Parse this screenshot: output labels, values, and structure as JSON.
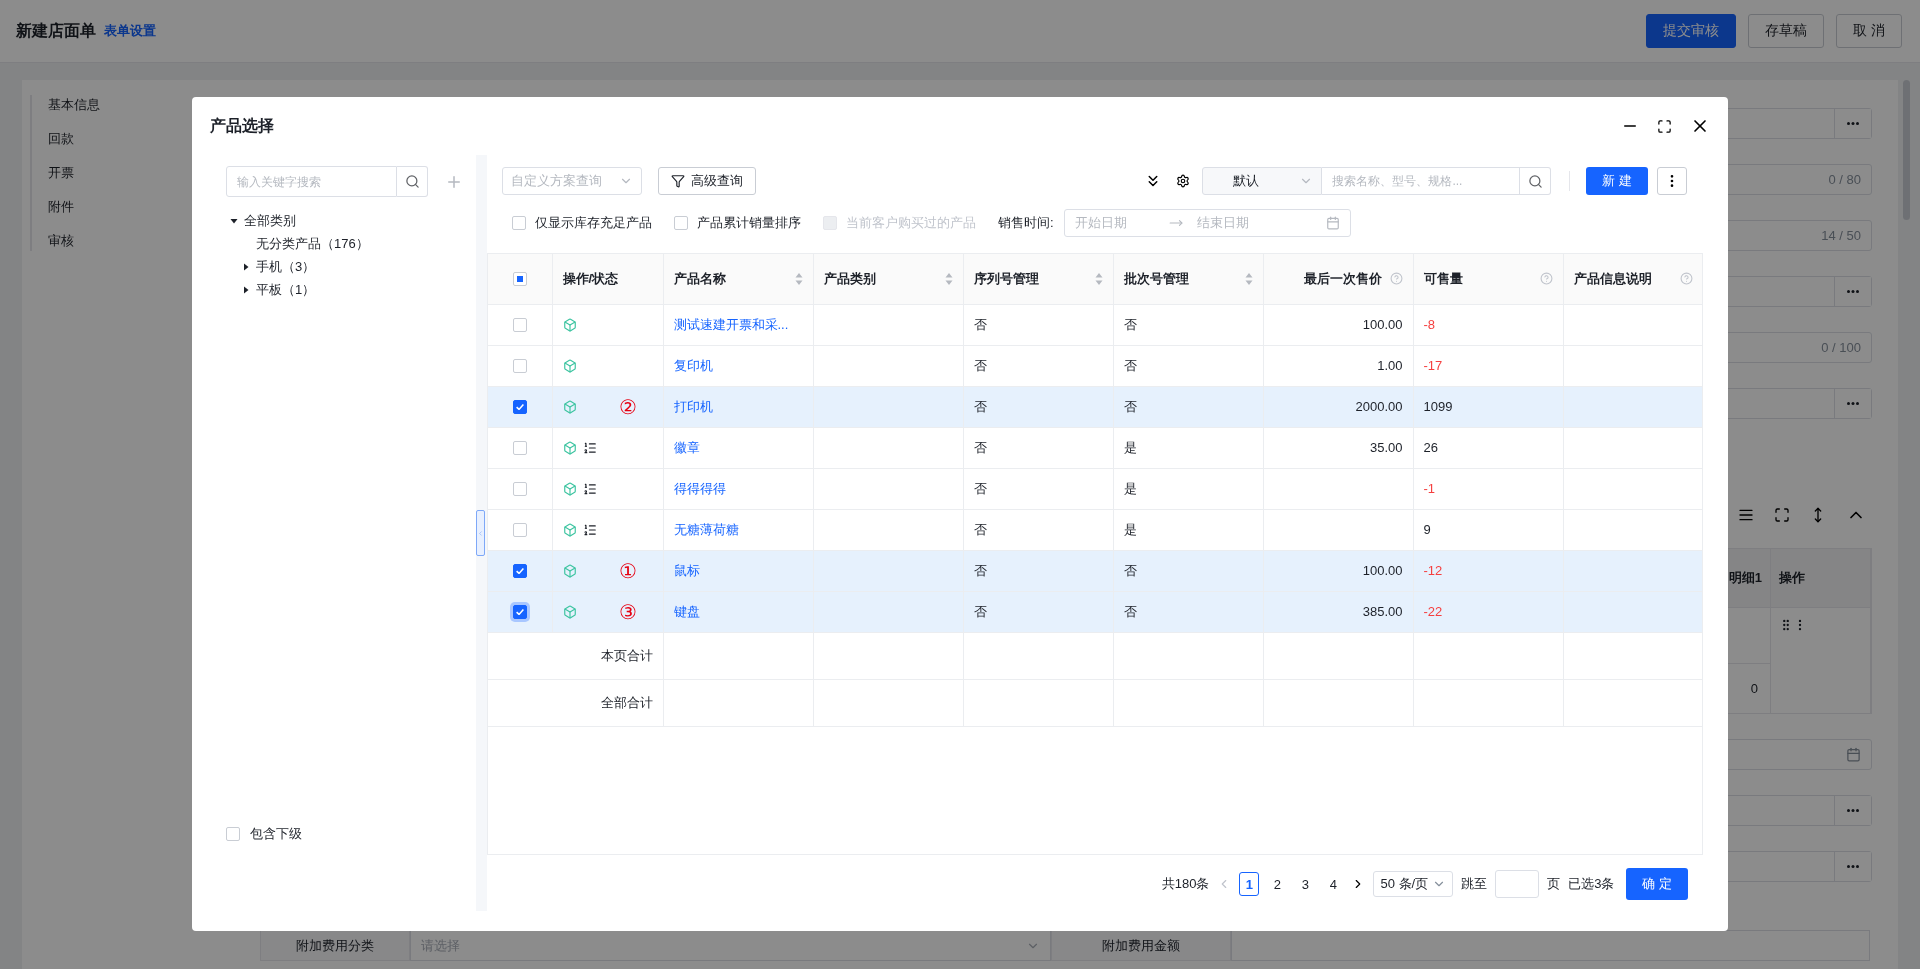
{
  "header": {
    "title": "新建店面单",
    "link": "表单设置",
    "buttons": [
      {
        "label": "提交审核",
        "primary": true
      },
      {
        "label": "存草稿",
        "primary": false
      },
      {
        "label": "取 消",
        "primary": false
      }
    ]
  },
  "nav": [
    "基本信息",
    "回款",
    "开票",
    "附件",
    "审核"
  ],
  "form_fields": [
    {
      "kind": "picker"
    },
    {
      "kind": "counter",
      "count": "0 / 80"
    },
    {
      "kind": "counter",
      "count": "14 / 50"
    },
    {
      "kind": "picker"
    },
    {
      "kind": "counter",
      "count": "0 / 100"
    },
    {
      "kind": "picker"
    }
  ],
  "detail_table": {
    "columns": [
      "明细1",
      "操作"
    ],
    "cell": "0"
  },
  "lower_fields": [
    {
      "kind": "date"
    },
    {
      "kind": "picker"
    },
    {
      "kind": "picker"
    }
  ],
  "fee_row": {
    "category_label": "附加费用分类",
    "category_placeholder": "请选择",
    "amount_label": "附加费用金额"
  },
  "dialog": {
    "title": "产品选择",
    "left": {
      "search_placeholder": "输入关键字搜索",
      "tree": [
        {
          "label": "全部类别",
          "expanded": true,
          "children": [
            {
              "label": "无分类产品（176）"
            },
            {
              "label": "手机（3）",
              "expanded": false
            },
            {
              "label": "平板（1）",
              "expanded": false
            }
          ]
        }
      ],
      "include_children": {
        "label": "包含下级",
        "checked": false
      }
    },
    "toolbar": {
      "scheme_placeholder": "自定义方案查询",
      "advanced": "高级查询",
      "sort_select": "默认",
      "search_placeholder": "搜索名称、型号、规格...",
      "new_button": "新 建"
    },
    "filters": [
      {
        "label": "仅显示库存充足产品",
        "checked": false,
        "disabled": false
      },
      {
        "label": "产品累计销量排序",
        "checked": false,
        "disabled": false
      },
      {
        "label": "当前客户购买过的产品",
        "checked": false,
        "disabled": true
      }
    ],
    "sale_time": {
      "label": "销售时间:",
      "start": "开始日期",
      "end": "结束日期"
    },
    "table": {
      "select_all_partial": true,
      "columns": [
        {
          "label": "操作/状态",
          "sortable": false,
          "help": false,
          "numeric": false
        },
        {
          "label": "产品名称",
          "sortable": true,
          "help": false,
          "numeric": false
        },
        {
          "label": "产品类别",
          "sortable": true,
          "help": false,
          "numeric": false
        },
        {
          "label": "序列号管理",
          "sortable": true,
          "help": false,
          "numeric": false
        },
        {
          "label": "批次号管理",
          "sortable": true,
          "help": false,
          "numeric": false
        },
        {
          "label": "最后一次售价",
          "sortable": false,
          "help": true,
          "numeric": true
        },
        {
          "label": "可售量",
          "sortable": false,
          "help": true,
          "numeric": false
        },
        {
          "label": "产品信息说明",
          "sortable": false,
          "help": true,
          "numeric": false
        }
      ],
      "rows": [
        {
          "checked": false,
          "focused": false,
          "list_icon": false,
          "name": "测试速建开票和采...",
          "serial": "否",
          "batch": "否",
          "price": "100.00",
          "stock": "-8",
          "stock_alert": true
        },
        {
          "checked": false,
          "focused": false,
          "list_icon": false,
          "name": "复印机",
          "serial": "否",
          "batch": "否",
          "price": "1.00",
          "stock": "-17",
          "stock_alert": true
        },
        {
          "checked": true,
          "focused": false,
          "list_icon": false,
          "mark": "②",
          "name": "打印机",
          "serial": "否",
          "batch": "否",
          "price": "2000.00",
          "stock": "1099",
          "stock_alert": false
        },
        {
          "checked": false,
          "focused": false,
          "list_icon": true,
          "name": "徽章",
          "serial": "否",
          "batch": "是",
          "price": "35.00",
          "stock": "26",
          "stock_alert": false
        },
        {
          "checked": false,
          "focused": false,
          "list_icon": true,
          "name": "得得得得",
          "serial": "否",
          "batch": "是",
          "stock": "-1",
          "stock_alert": true
        },
        {
          "checked": false,
          "focused": false,
          "list_icon": true,
          "name": "无糖薄荷糖",
          "serial": "否",
          "batch": "是",
          "stock": "9",
          "stock_alert": false
        },
        {
          "checked": true,
          "focused": false,
          "list_icon": false,
          "mark": "①",
          "name": "鼠标",
          "serial": "否",
          "batch": "否",
          "price": "100.00",
          "stock": "-12",
          "stock_alert": true
        },
        {
          "checked": true,
          "focused": true,
          "list_icon": false,
          "mark": "③",
          "name": "键盘",
          "serial": "否",
          "batch": "否",
          "price": "385.00",
          "stock": "-22",
          "stock_alert": true
        }
      ],
      "totals": [
        "本页合计",
        "全部合计"
      ]
    },
    "pagination": {
      "total": "共180条",
      "pages": [
        {
          "label": "1",
          "selected": true
        },
        {
          "label": "2",
          "selected": false
        },
        {
          "label": "3",
          "selected": false
        },
        {
          "label": "4",
          "selected": false
        }
      ],
      "page_size": "50 条/页",
      "jump_label": "跳至",
      "page_unit": "页",
      "selected_count": "已选3条",
      "confirm": "确 定"
    }
  }
}
